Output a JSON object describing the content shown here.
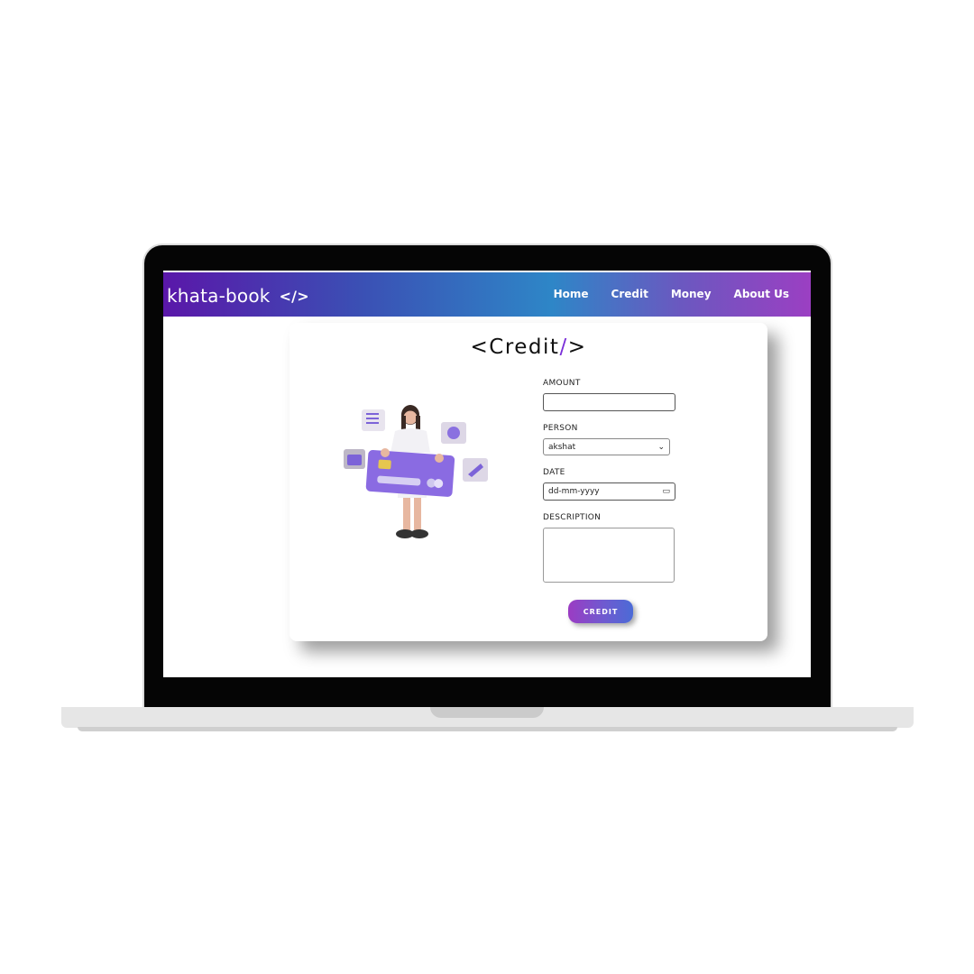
{
  "brand": {
    "name": "khata-book",
    "code_icon": "</>"
  },
  "nav": {
    "items": [
      "Home",
      "Credit",
      "Money",
      "About Us"
    ]
  },
  "card": {
    "title_prefix": "<Credit",
    "title_slash": "/",
    "title_suffix": ">"
  },
  "form": {
    "amount_label": "AMOUNT",
    "amount_value": "",
    "person_label": "PERSON",
    "person_value": "akshat",
    "date_label": "DATE",
    "date_placeholder": "dd-mm-yyyy",
    "description_label": "DESCRIPTION",
    "description_value": "",
    "submit_label": "CREDIT"
  },
  "colors": {
    "accent": "#7a2fd8",
    "nav_start": "#5a17a9",
    "nav_mid": "#2e86c7",
    "nav_end": "#9b3fc2"
  },
  "icons": {
    "select": "chevron-down-icon",
    "date": "calendar-icon"
  }
}
